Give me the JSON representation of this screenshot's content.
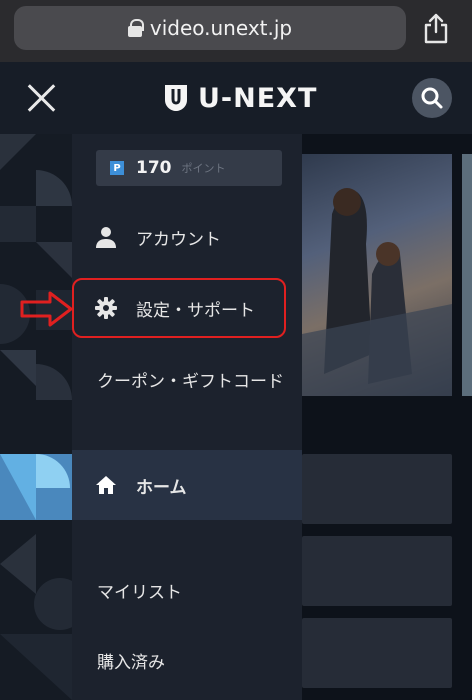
{
  "browser": {
    "url": "video.unext.jp"
  },
  "header": {
    "logo_text": "U-NEXT"
  },
  "menu": {
    "points_badge": "P",
    "points_value": "170",
    "points_unit": "ポイント",
    "items": [
      {
        "label": "アカウント",
        "icon": "person-icon"
      },
      {
        "label": "設定・サポート",
        "icon": "gear-icon"
      },
      {
        "label": "クーポン・ギフトコード"
      },
      {
        "label": "ホーム",
        "icon": "home-icon"
      },
      {
        "label": "マイリスト"
      },
      {
        "label": "購入済み"
      }
    ]
  },
  "colors": {
    "highlight": "#e02020",
    "accent": "#3d8fd8"
  }
}
